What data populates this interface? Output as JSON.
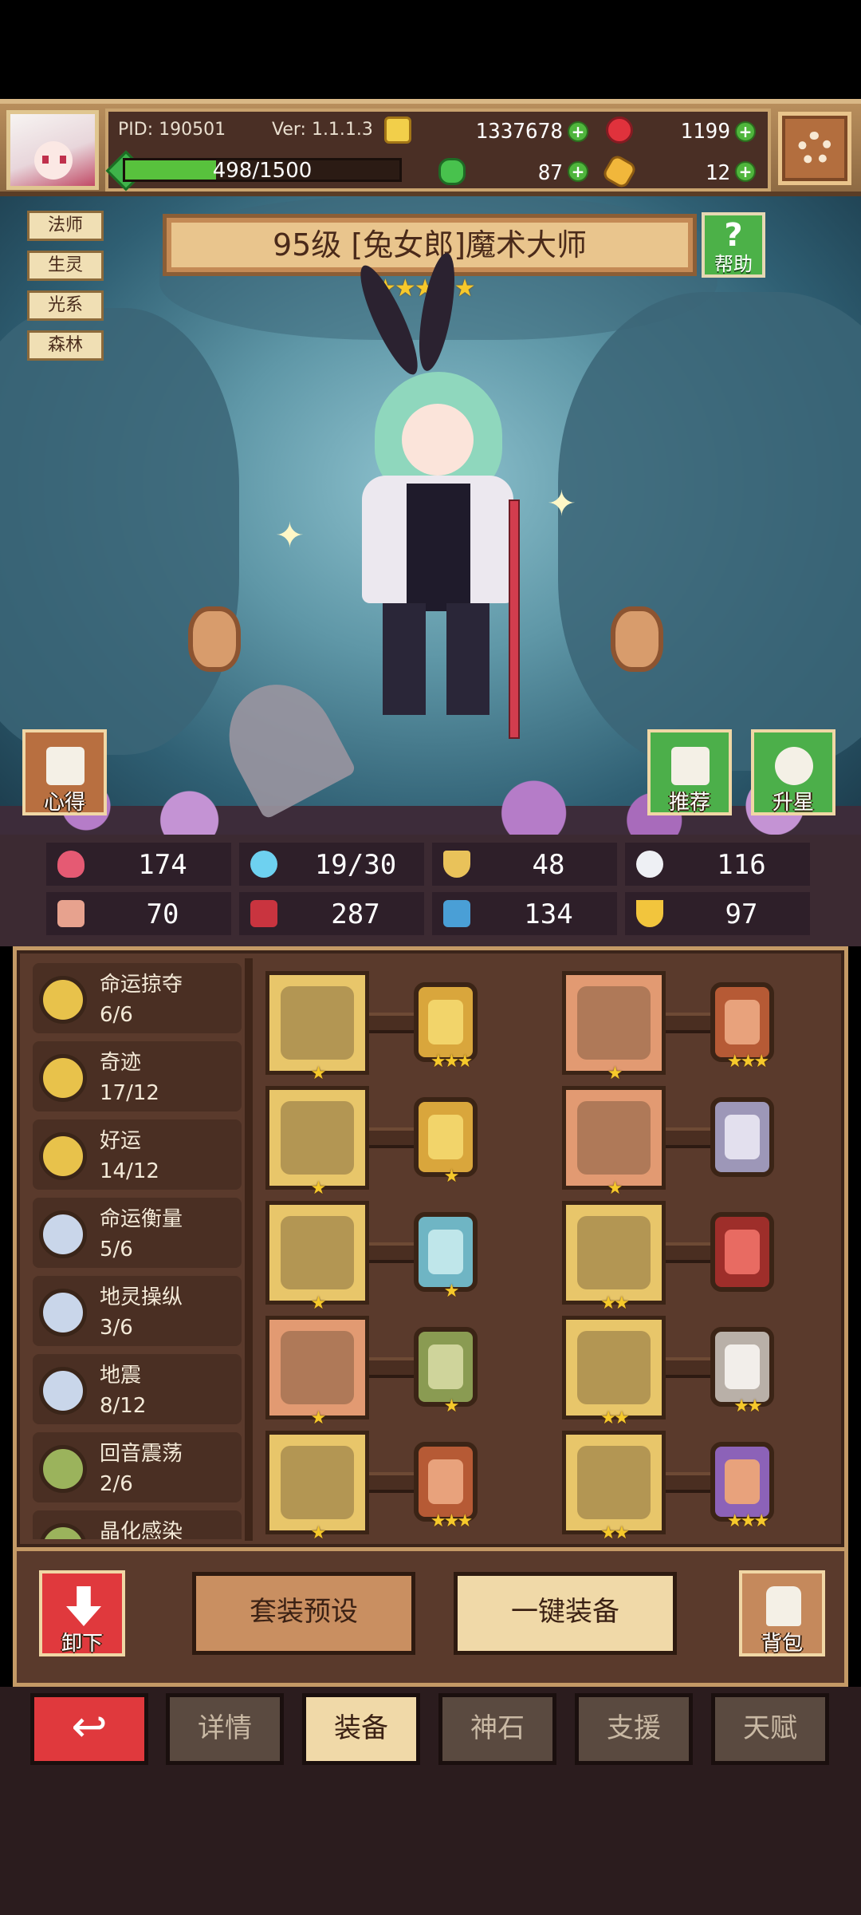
{
  "header": {
    "pid": "PID: 190501",
    "version": "Ver: 1.1.1.3",
    "gold": "1337678",
    "rubies": "1199",
    "clovers": "87",
    "keys": "12",
    "xp": "498/1500",
    "xp_fraction": 0.332
  },
  "character": {
    "tags": [
      "法师",
      "生灵",
      "光系",
      "森林"
    ],
    "title": "95级 [兔女郎]魔术大师",
    "stars": 5,
    "help_label": "帮助",
    "notes_label": "心得",
    "recommend_label": "推荐",
    "upgrade_label": "升星"
  },
  "stats": [
    "174",
    "19/30",
    "48",
    "116",
    "70",
    "287",
    "134",
    "97"
  ],
  "skills": [
    {
      "name": "命运掠夺",
      "count": "6/6",
      "color": "#e8c24b"
    },
    {
      "name": "奇迹",
      "count": "17/12",
      "color": "#e8c24b"
    },
    {
      "name": "好运",
      "count": "14/12",
      "color": "#e8c24b"
    },
    {
      "name": "命运衡量",
      "count": "5/6",
      "color": "#c9d6ea"
    },
    {
      "name": "地灵操纵",
      "count": "3/6",
      "color": "#c9d6ea"
    },
    {
      "name": "地震",
      "count": "8/12",
      "color": "#c9d6ea"
    },
    {
      "name": "回音震荡",
      "count": "2/6",
      "color": "#9bb35c"
    },
    {
      "name": "晶化感染",
      "count": "",
      "color": "#9bb35c"
    }
  ],
  "equipment": {
    "left": [
      {
        "item": "axe",
        "item_stars": 1,
        "gem_stars": 3,
        "bg": "#e8c66a",
        "gem": "#f2d46a",
        "gem_frame": "#d9a63c"
      },
      {
        "item": "orb",
        "item_stars": 1,
        "gem_stars": 1,
        "bg": "#e8c66a",
        "gem": "#f2d46a",
        "gem_frame": "#d9a63c"
      },
      {
        "item": "necklace",
        "item_stars": 1,
        "gem_stars": 1,
        "bg": "#e8c66a",
        "gem": "#bfe6ea",
        "gem_frame": "#6fb5c4"
      },
      {
        "item": "amulet",
        "item_stars": 1,
        "gem_stars": 1,
        "bg": "#e29a72",
        "gem": "#cfd49b",
        "gem_frame": "#8a9b52"
      },
      {
        "item": "ring",
        "item_stars": 1,
        "gem_stars": 3,
        "bg": "#e8c66a",
        "gem": "#e8a27c",
        "gem_frame": "#b65a35"
      }
    ],
    "right": [
      {
        "item": "hat",
        "item_stars": 1,
        "gem_stars": 3,
        "bg": "#e29a72",
        "gem": "#e8a27c",
        "gem_frame": "#b65a35"
      },
      {
        "item": "armor",
        "item_stars": 1,
        "gem_stars": 0,
        "bg": "#e29a72",
        "gem": "#e3e0ee",
        "gem_frame": "#9d97b8"
      },
      {
        "item": "bracer",
        "item_stars": 2,
        "gem_stars": 0,
        "bg": "#e8c66a",
        "gem": "#e86b62",
        "gem_frame": "#9e2e2a"
      },
      {
        "item": "belt",
        "item_stars": 2,
        "gem_stars": 2,
        "bg": "#e8c66a",
        "gem": "#f2eeea",
        "gem_frame": "#b9b0a8"
      },
      {
        "item": "boots",
        "item_stars": 2,
        "gem_stars": 3,
        "bg": "#e8c66a",
        "gem": "#e8a27c",
        "gem_frame": "#8c62b8"
      }
    ]
  },
  "actions": {
    "unequip": "卸下",
    "preset": "套装预设",
    "auto_equip": "一键装备",
    "bag": "背包"
  },
  "tabs": [
    "详情",
    "装备",
    "神石",
    "支援",
    "天赋"
  ],
  "active_tab": 1,
  "colors": {
    "accent_red": "#e0393d",
    "gold": "#f6c92b",
    "green": "#4fb53c"
  }
}
